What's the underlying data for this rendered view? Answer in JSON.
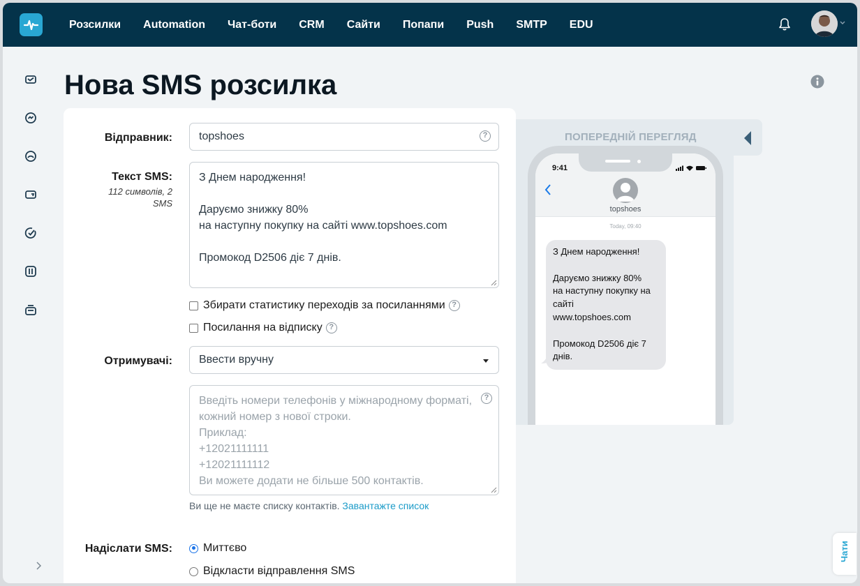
{
  "nav": {
    "items": [
      "Розсилки",
      "Automation",
      "Чат-боти",
      "CRM",
      "Сайти",
      "Попапи",
      "Push",
      "SMTP",
      "EDU"
    ]
  },
  "page": {
    "title": "Нова SMS розсилка"
  },
  "form": {
    "sender_label": "Відправник:",
    "sender_value": "topshoes",
    "text_label": "Текст SMS:",
    "text_meta": "112 символів, 2 SMS",
    "text_value": "З Днем народження!\n\nДаруємо знижку 80%\nна наступну покупку на сайті www.topshoes.com\n\nПромокод D2506 діє 7 днів.",
    "track_clicks_label": "Збирати статистику переходів за посиланнями",
    "track_clicks_checked": false,
    "unsubscribe_label": "Посилання на відписку",
    "unsubscribe_checked": false,
    "recipients_label": "Отримувачі:",
    "recipients_selected": "Ввести вручну",
    "phones_placeholder": "Введіть номери телефонів у міжнародному форматі, кожний номер з нової строки.\n Приклад:\n +12021111111\n +12021111112\n Ви можете додати не більше 500 контактів.",
    "hint_text": "Ви ще не маєте списку контактів.",
    "hint_link": "Завантажте список",
    "send_label": "Надіслати SMS:",
    "send_now_label": "Миттєво",
    "send_later_label": "Відкласти відправлення SMS",
    "send_mode": "now"
  },
  "preview": {
    "title": "ПОПЕРЕДНІЙ ПЕРЕГЛЯД",
    "phone_time": "9:41",
    "contact_name": "topshoes",
    "message_time": "Today, 09:40",
    "message_text": "З Днем народження!\n\nДаруємо знижку 80%\nна наступну покупку на сайті\nwww.topshoes.com\n\nПромокод D2506 діє 7 днів."
  },
  "chat_tab": {
    "label": "Чати"
  },
  "colors": {
    "topbar": "#04334a",
    "accent": "#29a7d3",
    "page_bg": "#f1f4f6",
    "link": "#1b9bc8"
  },
  "icons": {
    "logo": "pulse-logo-icon",
    "notifications": "bell-icon",
    "info": "info-icon",
    "help": "question-circle-icon",
    "sidebar": [
      "email-campaign-icon",
      "automation-icon",
      "chatbot-icon",
      "sms-icon",
      "check-icon",
      "push-icon",
      "contacts-icon"
    ]
  }
}
